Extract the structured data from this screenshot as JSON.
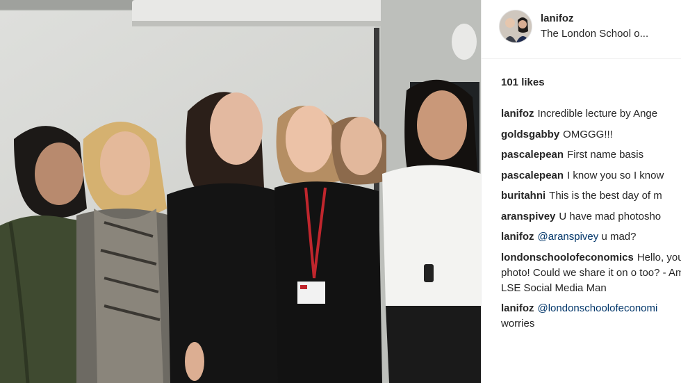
{
  "post": {
    "username": "lanifoz",
    "location": "The London School o...",
    "likes_text": "101 likes"
  },
  "comments": [
    {
      "user": "lanifoz",
      "text": "Incredible lecture by Ange"
    },
    {
      "user": "goldsgabby",
      "text": "OMGGG!!!"
    },
    {
      "user": "pascalepean",
      "text": "First name basis"
    },
    {
      "user": "pascalepean",
      "text": "I know you so I know"
    },
    {
      "user": "buritahni",
      "text": "This is the best day of m"
    },
    {
      "user": "aranspivey",
      "text": "U have mad photosho"
    },
    {
      "user": "lanifoz",
      "mention": "@aranspivey",
      "text": " u mad?"
    },
    {
      "user": "londonschoolofeconomics",
      "text": "Hello, your photo! Could we share it on o too? - Amy, LSE Social Media Man"
    },
    {
      "user": "lanifoz",
      "mention": "@londonschoolofeconomi",
      "text": "worries"
    }
  ],
  "icons": {
    "avatar": "profile-photo",
    "photo": "group-photo"
  },
  "colors": {
    "text": "#262626",
    "mention": "#003569",
    "divider": "#efefef"
  }
}
